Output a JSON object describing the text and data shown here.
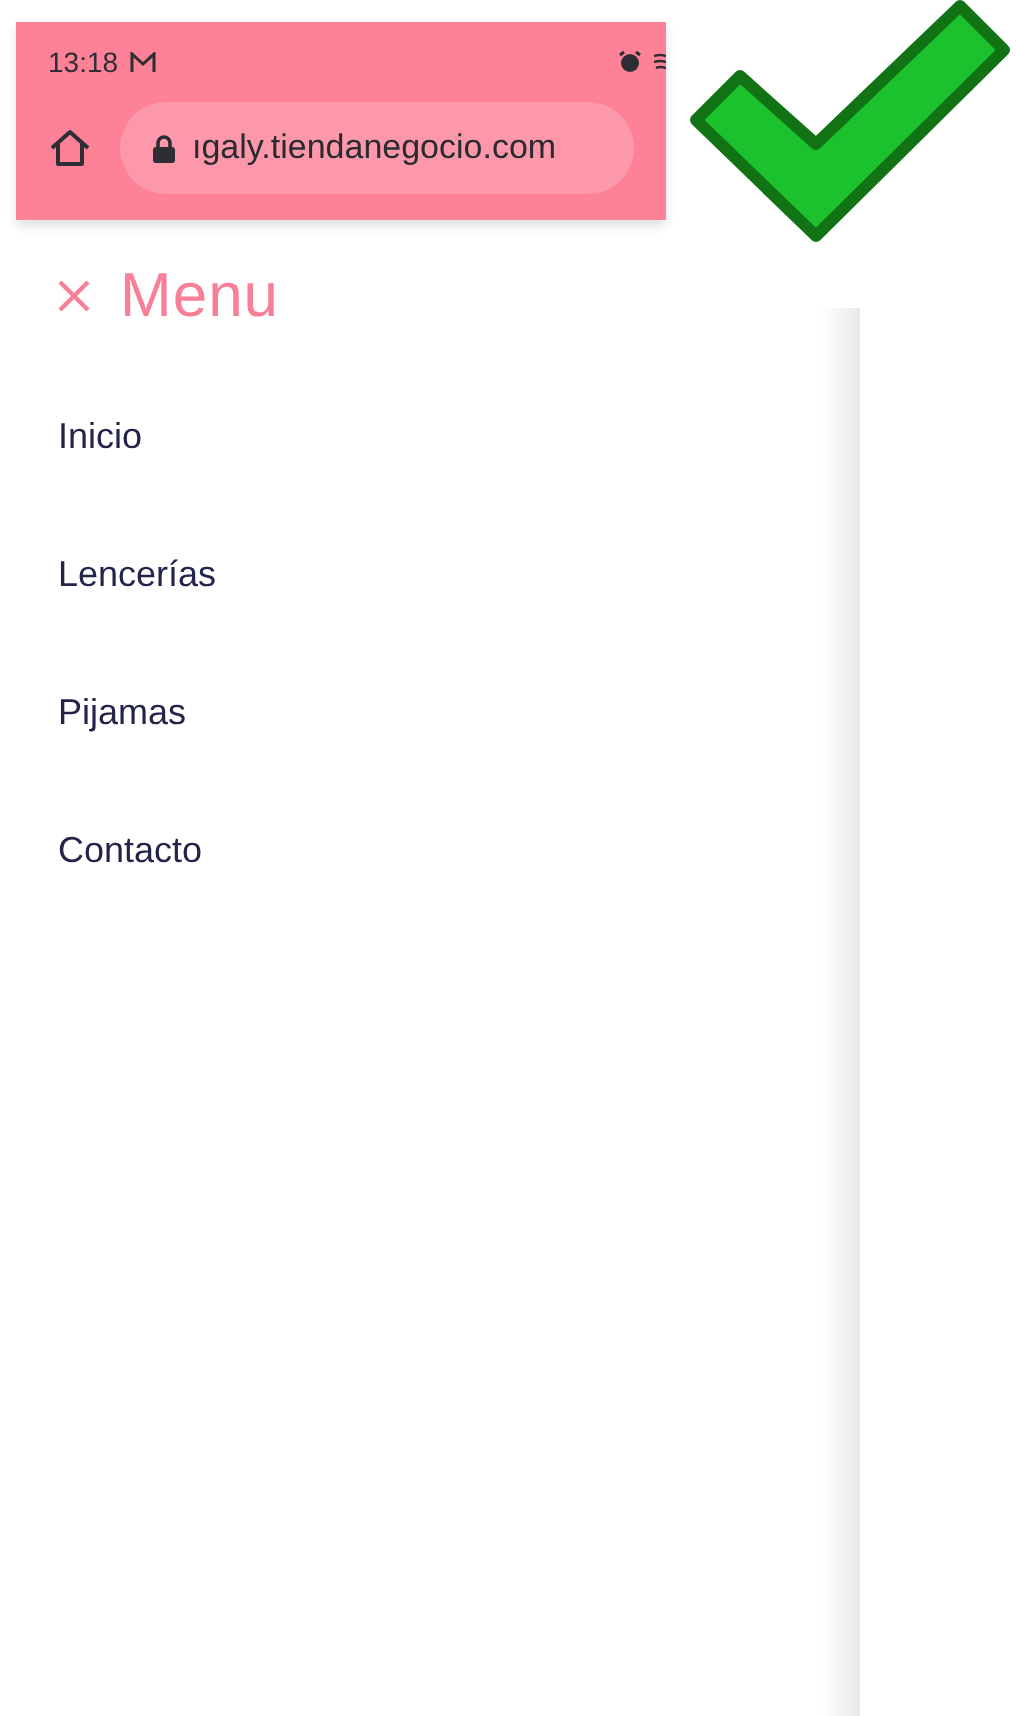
{
  "status_bar": {
    "time": "13:18"
  },
  "browser": {
    "url": "ıgaly.tiendanegocio.com"
  },
  "menu": {
    "title": "Menu",
    "items": [
      {
        "label": "Inicio"
      },
      {
        "label": "Lencerías"
      },
      {
        "label": "Pijamas"
      },
      {
        "label": "Contacto"
      }
    ]
  }
}
